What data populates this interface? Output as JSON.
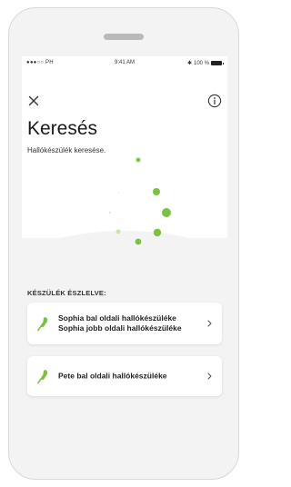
{
  "statusbar": {
    "carrier": "●●●○○ PH",
    "time": "9:41 AM",
    "battery": "100 %"
  },
  "header": {
    "title": "Keresés",
    "subtitle": "Hallókészülék keresése."
  },
  "section": {
    "label": "KÉSZÜLÉK ÉSZLELVE:"
  },
  "devices": [
    {
      "line1": "Sophia bal oldali hallókészüléke",
      "line2": "Sophia jobb oldali hallókészüléke"
    },
    {
      "line1": "Pete bal oldali hallókészüléke",
      "line2": ""
    }
  ],
  "colors": {
    "accent": "#7cc242",
    "accent_light": "#c6e6a8"
  },
  "icons": {
    "close": "close-icon",
    "info": "info-icon",
    "device": "hearing-aid-icon",
    "chevron": "chevron-right-icon"
  }
}
